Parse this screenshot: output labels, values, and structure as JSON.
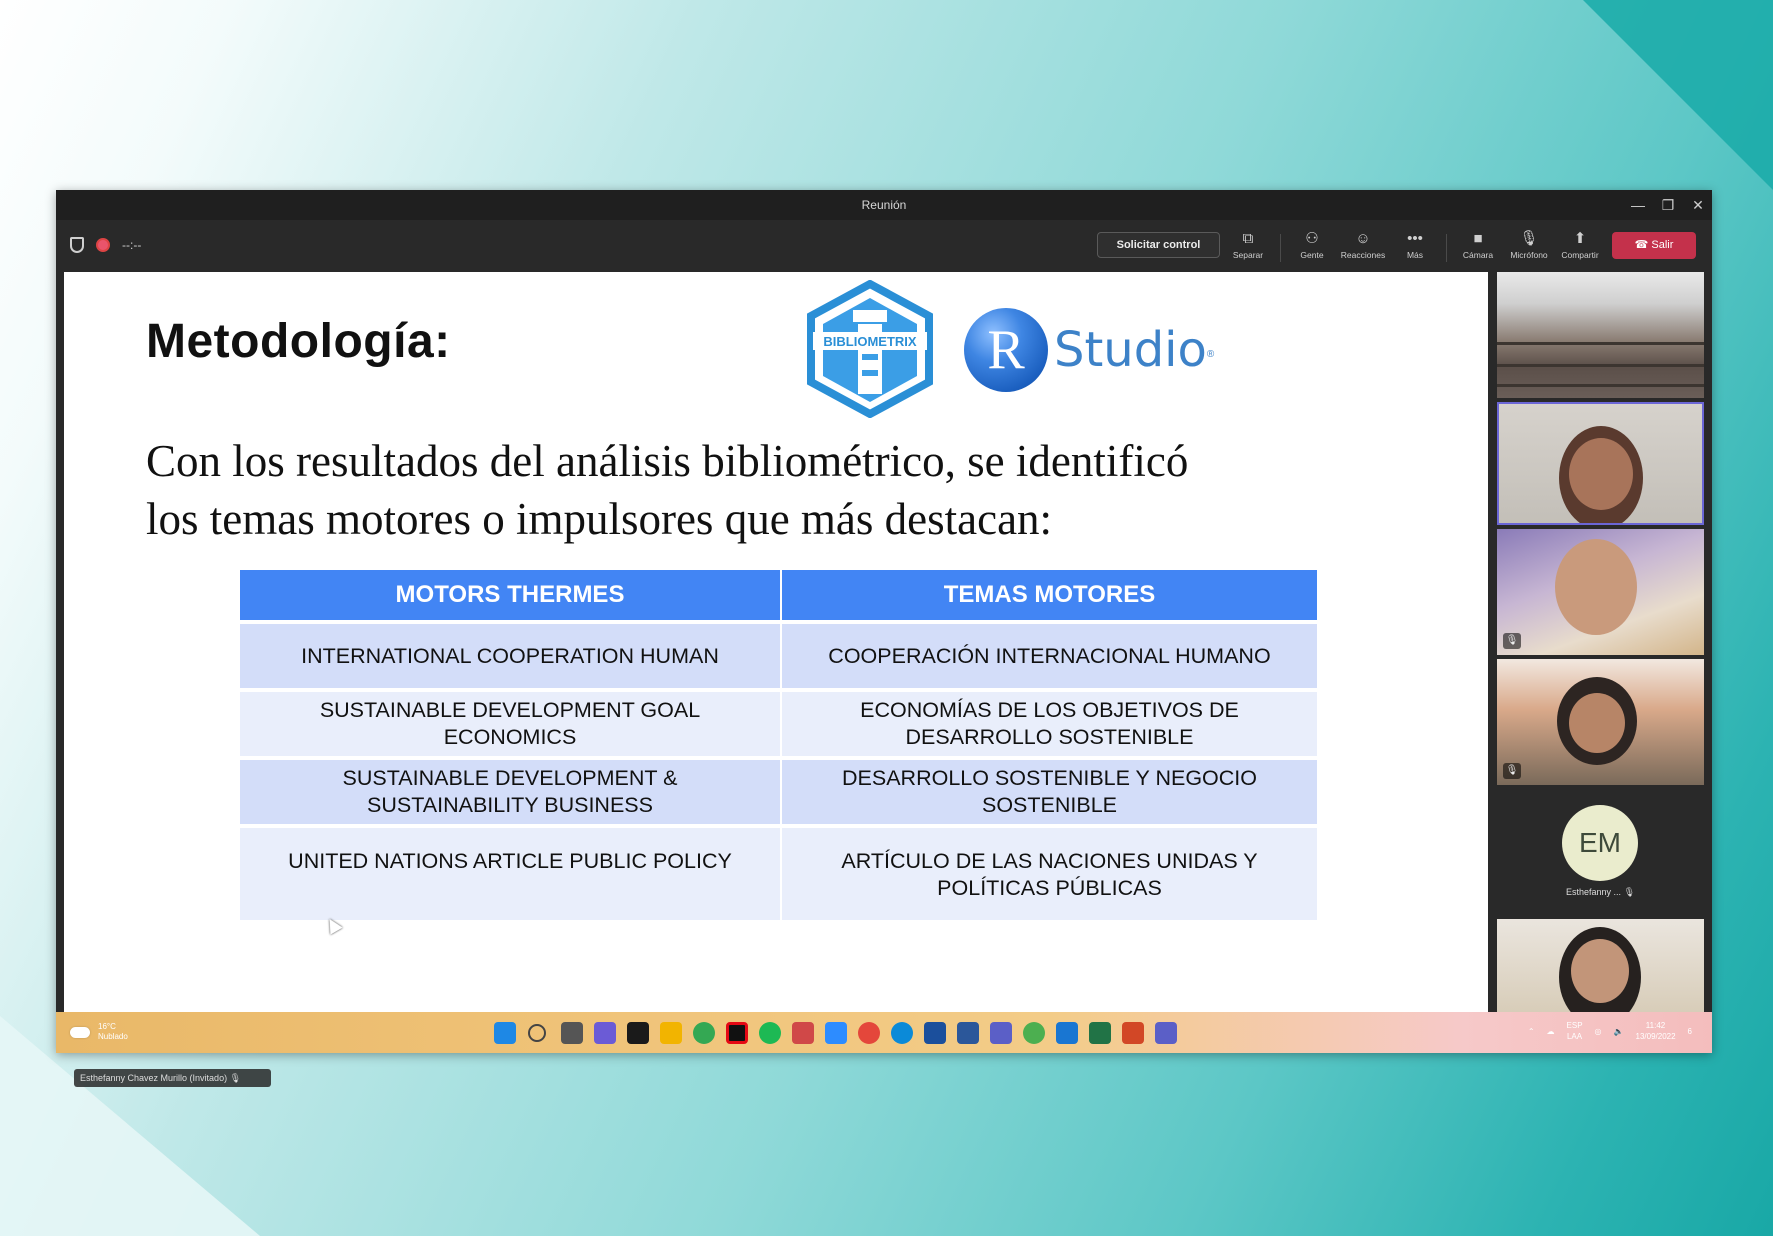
{
  "window": {
    "title": "Reunión",
    "minimize": "—",
    "restore": "❐",
    "close": "✕"
  },
  "toolbar": {
    "timer": "--:--",
    "request_control": "Solicitar control",
    "items": [
      {
        "label": "Separar",
        "icon": "pop-out-icon"
      },
      {
        "label": "Gente",
        "icon": "people-icon"
      },
      {
        "label": "Reacciones",
        "icon": "reactions-icon"
      },
      {
        "label": "Más",
        "icon": "more-icon"
      },
      {
        "label": "Cámara",
        "icon": "camera-icon"
      },
      {
        "label": "Micrófono",
        "icon": "microphone-off-icon"
      },
      {
        "label": "Compartir",
        "icon": "share-icon"
      }
    ],
    "leave": "Salir",
    "leave_color": "#c4314b"
  },
  "slide": {
    "title": "Metodología:",
    "logo_text": "BIBLIOMETRIX",
    "rstudio_r": "R",
    "rstudio_word": "Studio",
    "rstudio_reg": "®",
    "body_line1": "Con los resultados del análisis bibliométrico, se identificó",
    "body_line2": "los temas motores o impulsores que más destacan:",
    "table": {
      "headers": [
        "MOTORS THERMES",
        "TEMAS MOTORES"
      ],
      "rows": [
        [
          "INTERNATIONAL COOPERATION HUMAN",
          "COOPERACIÓN INTERNACIONAL HUMANO"
        ],
        [
          "SUSTAINABLE DEVELOPMENT GOAL ECONOMICS",
          "ECONOMÍAS DE LOS  OBJETIVOS DE DESARROLLO SOSTENIBLE"
        ],
        [
          "SUSTAINABLE DEVELOPMENT & SUSTAINABILITY BUSINESS",
          "DESARROLLO SOSTENIBLE Y NEGOCIO SOSTENIBLE"
        ],
        [
          "UNITED NATIONS ARTICLE PUBLIC POLICY",
          "ARTÍCULO DE LAS NACIONES UNIDAS Y POLÍTICAS PÚBLICAS"
        ]
      ],
      "header_color": "#4285f4"
    }
  },
  "presenter_tag": "Esthefanny Chavez Murillo (Invitado)",
  "gallery": {
    "avatar_initials": "EM",
    "avatar_name": "Esthefanny ..."
  },
  "taskbar": {
    "weather_temp": "16°C",
    "weather_desc": "Nublado",
    "lang_top": "ESP",
    "lang_bottom": "LAA",
    "time": "11:42",
    "date": "13/09/2022",
    "notifications": "6"
  }
}
